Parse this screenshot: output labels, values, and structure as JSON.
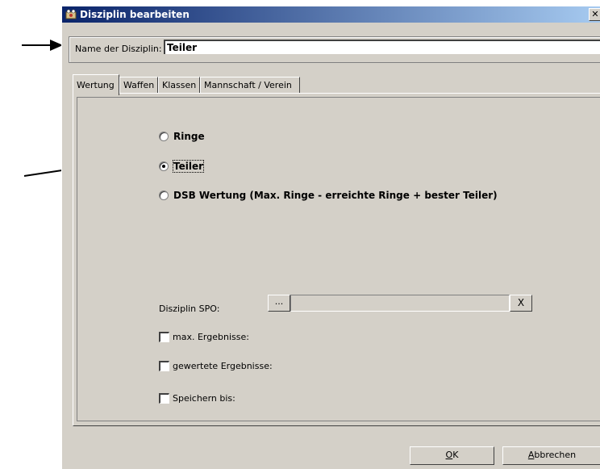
{
  "window": {
    "title": "Disziplin bearbeiten",
    "close_glyph": "✕"
  },
  "name_field": {
    "label": "Name der Disziplin:",
    "value": "Teiler"
  },
  "tabs": [
    {
      "label": "Wertung",
      "active": true
    },
    {
      "label": "Waffen",
      "active": false
    },
    {
      "label": "Klassen",
      "active": false
    },
    {
      "label": "Mannschaft / Verein",
      "active": false
    }
  ],
  "scoring": {
    "options": [
      {
        "label": "Ringe",
        "checked": false
      },
      {
        "label": "Teiler",
        "checked": true
      },
      {
        "label": "DSB Wertung (Max. Ringe - erreichte Ringe + bester Teiler)",
        "checked": false
      }
    ]
  },
  "spo": {
    "label": "Disziplin SPO:",
    "browse_label": "...",
    "value": "",
    "clear_label": "X"
  },
  "checkboxes": [
    {
      "label": "max. Ergebnisse:",
      "checked": false
    },
    {
      "label": "gewertete Ergebnisse:",
      "checked": false
    },
    {
      "label": "Speichern bis:",
      "checked": false
    }
  ],
  "buttons": {
    "ok": {
      "mnemonic": "O",
      "rest": "K"
    },
    "cancel": {
      "mnemonic": "A",
      "rest": "bbrechen"
    }
  },
  "colors": {
    "face": "#d4d0c8",
    "title_start": "#0a246a",
    "title_end": "#a6caf0"
  }
}
